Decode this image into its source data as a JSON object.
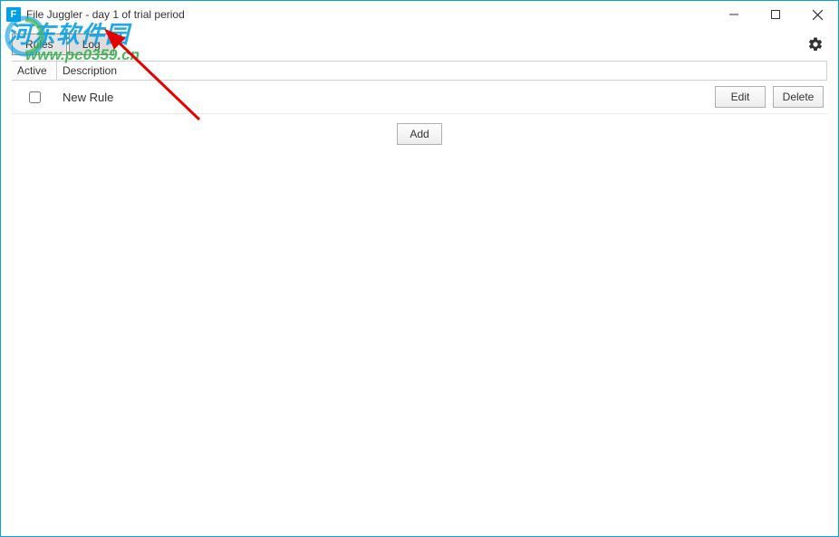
{
  "window": {
    "title": "File Juggler - day 1 of trial period",
    "app_icon_letter": "F"
  },
  "toolbar": {
    "tabs": {
      "rules": "Rules",
      "log": "Log"
    }
  },
  "list": {
    "headers": {
      "active": "Active",
      "description": "Description"
    },
    "rows": [
      {
        "description": "New Rule",
        "checked": false
      }
    ],
    "actions": {
      "edit": "Edit",
      "delete": "Delete",
      "add": "Add"
    }
  },
  "watermark": {
    "line1": "河东软件园",
    "line2": "www.pc0359.cn"
  }
}
